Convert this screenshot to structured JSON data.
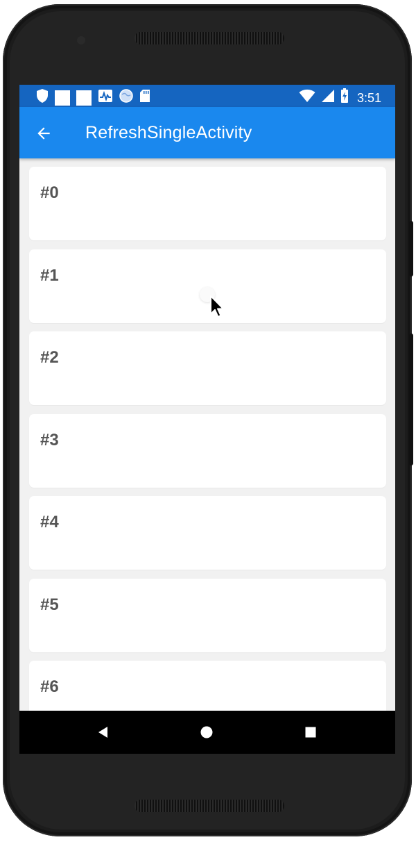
{
  "status_bar": {
    "time": "3:51",
    "left_icons": [
      "shield-icon",
      "notification-square-icon",
      "notification-square-icon",
      "activity-monitor-icon",
      "globe-icon",
      "sd-card-icon"
    ],
    "right_icons": [
      "wifi-icon",
      "cell-signal-icon",
      "battery-charging-icon"
    ],
    "color": "#1565c0"
  },
  "app_bar": {
    "title": "RefreshSingleActivity",
    "back_icon": "arrow-back-icon",
    "color": "#1a88ee"
  },
  "list": {
    "items": [
      {
        "label": "#0"
      },
      {
        "label": "#1"
      },
      {
        "label": "#2"
      },
      {
        "label": "#3"
      },
      {
        "label": "#4"
      },
      {
        "label": "#5"
      },
      {
        "label": "#6"
      }
    ]
  },
  "nav_bar": {
    "icons": [
      "nav-back-icon",
      "nav-home-icon",
      "nav-recents-icon"
    ]
  }
}
